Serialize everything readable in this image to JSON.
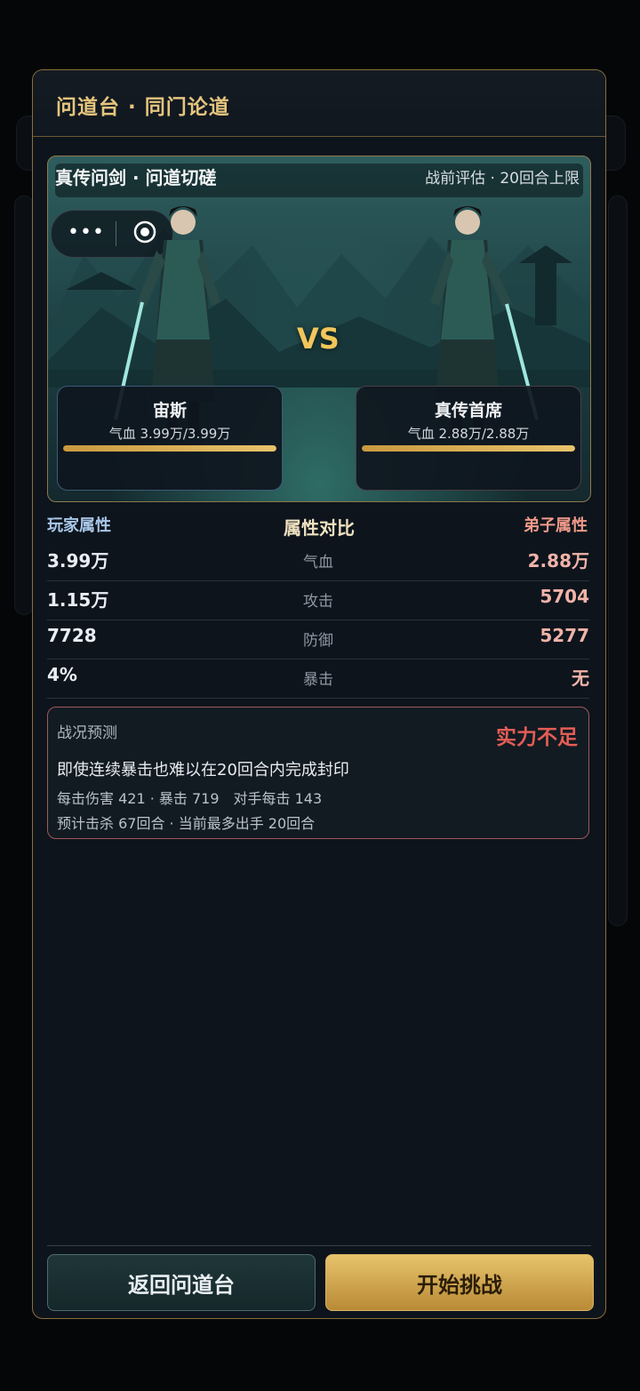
{
  "header": {
    "title": "问道台 · 同门论道"
  },
  "scene": {
    "title": "真传问剑 · 问道切磋",
    "subtitle": "战前评估 · 20回合上限",
    "vs": "VS",
    "capsule": {
      "more_icon": "more-dots-icon",
      "target_icon": "target-icon"
    }
  },
  "player": {
    "name": "宙斯",
    "hp_text": "气血 3.99万/3.99万",
    "hp_fraction": 1.0
  },
  "opponent": {
    "name": "真传首席",
    "hp_text": "气血 2.88万/2.88万",
    "hp_fraction": 1.0
  },
  "attributes": {
    "player_header": "玩家属性",
    "compare_header": "属性对比",
    "opponent_header": "弟子属性",
    "rows": [
      {
        "name": "气血",
        "player": "3.99万",
        "opponent": "2.88万"
      },
      {
        "name": "攻击",
        "player": "1.15万",
        "opponent": "5704"
      },
      {
        "name": "防御",
        "player": "7728",
        "opponent": "5277"
      },
      {
        "name": "暴击",
        "player": "4%",
        "opponent": "无"
      }
    ]
  },
  "prediction": {
    "label": "战况预测",
    "verdict": "实力不足",
    "summary": "即使连续暴击也难以在20回合内完成封印",
    "detail1": "每击伤害 421 · 暴击 719　对手每击 143",
    "detail2": "预计击杀 67回合 · 当前最多出手 20回合"
  },
  "buttons": {
    "back": "返回问道台",
    "start": "开始挑战"
  },
  "colors": {
    "gold": "#e6c57e",
    "danger": "#e35d55",
    "accent_blue": "#a9c7e8"
  }
}
